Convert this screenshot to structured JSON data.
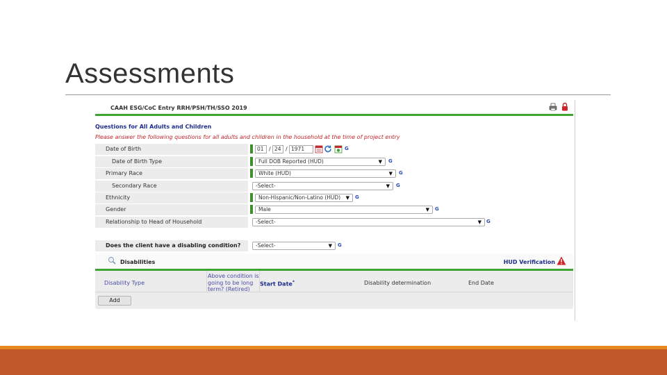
{
  "slide": {
    "title": "Assessments"
  },
  "form": {
    "title": "CAAH ESG/CoC Entry RRH/PSH/TH/SSO 2019",
    "section_heading": "Questions for All Adults and Children",
    "instructions": "Please answer the following questions for all adults and children in the household at the time of project entry",
    "g_label": "G",
    "fields": {
      "dob": {
        "label": "Date of Birth",
        "month": "01",
        "day": "24",
        "year": "1971",
        "sep": "/"
      },
      "dob_type": {
        "label": "Date of Birth Type",
        "value": "Full DOB Reported (HUD)"
      },
      "primary_race": {
        "label": "Primary Race",
        "value": "White (HUD)"
      },
      "secondary_race": {
        "label": "Secondary Race",
        "value": "-Select-"
      },
      "ethnicity": {
        "label": "Ethnicity",
        "value": "Non-Hispanic/Non-Latino (HUD)"
      },
      "gender": {
        "label": "Gender",
        "value": "Male"
      },
      "relationship": {
        "label": "Relationship to Head of Household",
        "value": "-Select-"
      }
    },
    "disabling": {
      "label": "Does the client have a disabling condition?",
      "value": "-Select-"
    },
    "disabilities": {
      "title": "Disabilities",
      "hud_link": "HUD Verification",
      "columns": {
        "disability_type": "Disability Type",
        "long_term_1": "Above condition is",
        "long_term_2": "going to be long",
        "long_term_3": "term? (Retired)",
        "start_date": "Start Date",
        "start_date_req": "*",
        "determination": "Disability determination",
        "end_date": "End Date"
      },
      "add_label": "Add"
    },
    "icons": {
      "print": "print-icon",
      "lock": "lock-icon",
      "calendar": "calendar-icon",
      "refresh": "refresh-icon",
      "search": "search-icon",
      "warning": "warning-icon"
    },
    "colors": {
      "green": "#3ea434",
      "heading_blue": "#1e2c8c",
      "instruction_red": "#c1272d",
      "footer_orange": "#c0582a"
    }
  }
}
